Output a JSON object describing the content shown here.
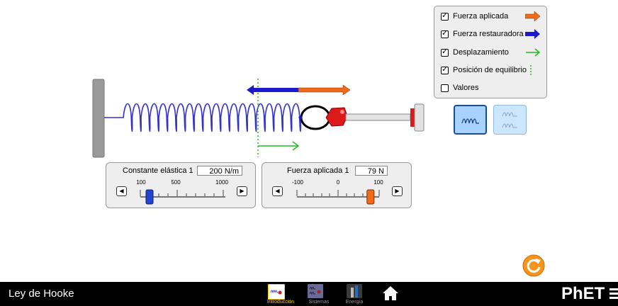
{
  "checkboxes": [
    {
      "label": "Fuerza aplicada",
      "checked": true,
      "indicator": "orange-arrow-icon"
    },
    {
      "label": "Fuerza restauradora",
      "checked": true,
      "indicator": "blue-arrow-icon"
    },
    {
      "label": "Desplazamiento",
      "checked": true,
      "indicator": "green-arrow-icon"
    },
    {
      "label": "Posición de equilibrio",
      "checked": true,
      "indicator": "green-dotted-line-icon"
    },
    {
      "label": "Valores",
      "checked": false,
      "indicator": ""
    }
  ],
  "spring_panel": {
    "title": "Constante elástica 1",
    "value": "200 N/m",
    "ticks": [
      "100",
      "500",
      "1000"
    ],
    "level": 0.111
  },
  "force_panel": {
    "title": "Fuerza aplicada 1",
    "value": "79 N",
    "ticks": [
      "-100",
      "0",
      "100"
    ],
    "level": 0.895
  },
  "nav": {
    "sim_title": "Ley de Hooke",
    "screens": [
      {
        "label": "Introducción",
        "selected": true
      },
      {
        "label": "Sistemas",
        "selected": false
      },
      {
        "label": "Energía",
        "selected": false
      }
    ],
    "brand": "PhET"
  },
  "colors": {
    "applied_force": "#f06a1a",
    "restoring_force": "#1a1acc",
    "displacement": "#22bb22",
    "spring": "#3333cc",
    "panel_bg": "#eeeeee",
    "selected_screen": "#ffd400",
    "reset_button": "#f7941d"
  }
}
